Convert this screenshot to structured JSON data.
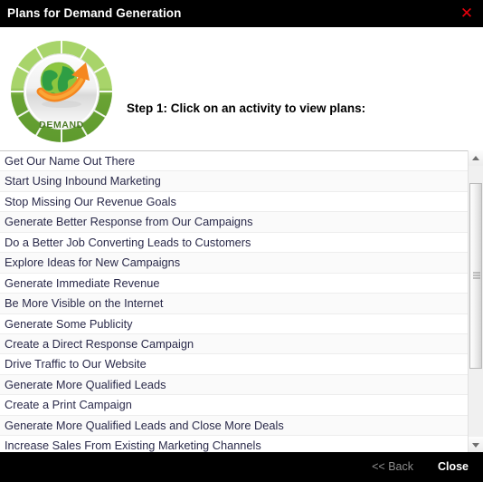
{
  "window": {
    "title": "Plans for Demand Generation",
    "close_icon": "close-x-icon",
    "titlebar_bg": "#000000",
    "close_icon_color": "#e8000c"
  },
  "header": {
    "logo": {
      "label": "DEMAND",
      "icon": "globe-arrow-icon",
      "ring_color_light": "#a8d46a",
      "ring_color_dark": "#5e9a2e",
      "arrow_color": "#f5871f"
    },
    "step_instruction": "Step 1: Click on an activity to view plans:"
  },
  "activity_list": {
    "items": [
      "Get Our Name Out There",
      "Start Using Inbound Marketing",
      "Stop Missing Our Revenue Goals",
      "Generate Better Response from Our Campaigns",
      "Do a Better Job Converting Leads to Customers",
      "Explore Ideas for New Campaigns",
      "Generate Immediate Revenue",
      "Be More Visible on the Internet",
      "Generate Some Publicity",
      "Create a Direct Response Campaign",
      "Drive Traffic to Our Website",
      "Generate More Qualified Leads",
      "Create a Print Campaign",
      "Generate More Qualified Leads and Close More Deals",
      "Increase Sales From Existing Marketing Channels"
    ]
  },
  "scrollbar": {
    "up_arrow_icon": "scroll-up-arrow-icon",
    "down_arrow_icon": "scroll-down-arrow-icon",
    "thumb_icon": "scrollbar-thumb-grip"
  },
  "footer": {
    "back_label": "<< Back",
    "close_label": "Close",
    "bg": "#000000",
    "back_color": "#8f8f8f",
    "close_color": "#ffffff"
  }
}
